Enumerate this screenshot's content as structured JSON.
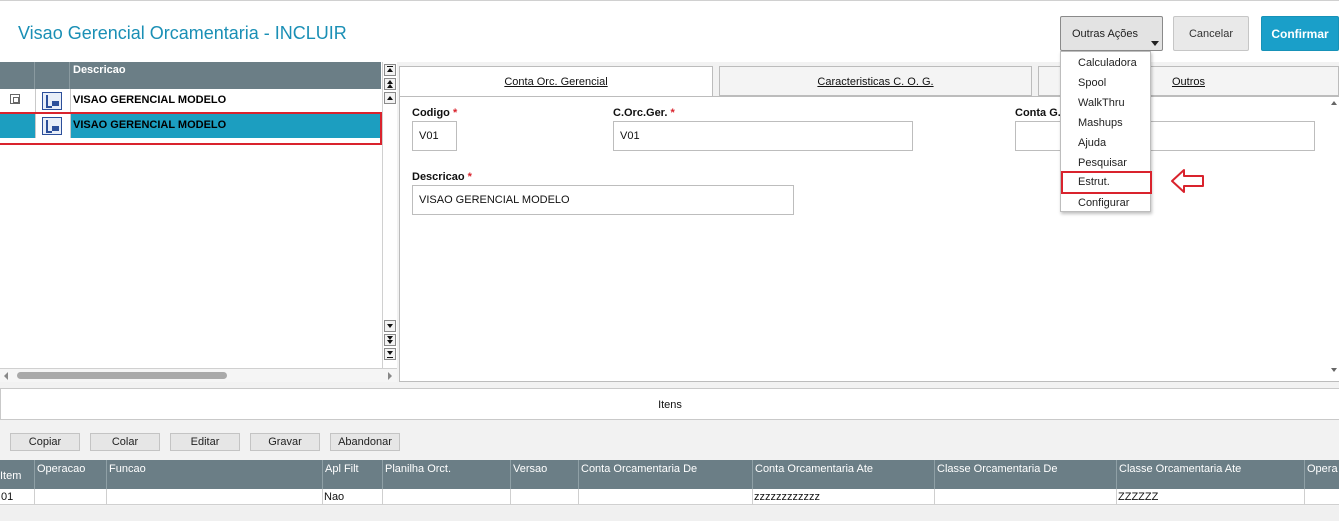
{
  "header": {
    "title": "Visao Gerencial Orcamentaria - INCLUIR",
    "outras_acoes_label": "Outras Ações",
    "cancelar_label": "Cancelar",
    "confirmar_label": "Confirmar"
  },
  "dropdown": {
    "items": [
      "Calculadora",
      "Spool",
      "WalkThru",
      "Mashups",
      "Ajuda",
      "Pesquisar",
      "Estrut.",
      "Configurar"
    ],
    "highlighted": "Estrut."
  },
  "tree": {
    "column_header": "Descricao",
    "rows": [
      {
        "label": "VISAO GERENCIAL MODELO"
      },
      {
        "label": "VISAO GERENCIAL MODELO"
      }
    ]
  },
  "tabs": [
    {
      "label": "Conta Orc. Gerencial"
    },
    {
      "label": "Caracteristicas C. O. G."
    },
    {
      "label": "Outros"
    }
  ],
  "form": {
    "codigo_label": "Codigo",
    "codigo_value": "V01",
    "corcger_label": "C.Orc.Ger.",
    "corcger_value": "V01",
    "contag_label": "Conta G...",
    "contag_value": "",
    "descricao_label": "Descricao",
    "descricao_value": "VISAO GERENCIAL MODELO",
    "required_mark": "*"
  },
  "itens": {
    "title": "Itens",
    "buttons": [
      "Copiar",
      "Colar",
      "Editar",
      "Gravar",
      "Abandonar"
    ]
  },
  "grid": {
    "headers": [
      "Item",
      "Operacao",
      "Funcao",
      "Apl Filt",
      "Planilha Orct.",
      "Versao",
      "Conta Orcamentaria De",
      "Conta Orcamentaria Ate",
      "Classe Orcamentaria De",
      "Classe Orcamentaria Ate",
      "Opera"
    ],
    "rows": [
      [
        "01",
        "",
        "",
        "Nao",
        "",
        "",
        "",
        "zzzzzzzzzzzz",
        "",
        "ZZZZZZ",
        ""
      ]
    ]
  },
  "colors": {
    "accent": "#1a9fc9",
    "title": "#1a8fb5",
    "grid_header": "#6b7e86",
    "selection": "#1c9ec0",
    "highlight_outline": "#d9232d"
  }
}
